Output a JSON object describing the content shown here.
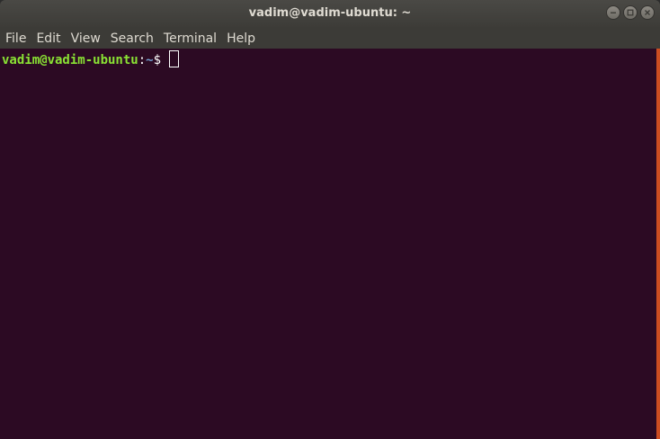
{
  "window": {
    "title": "vadim@vadim-ubuntu: ~",
    "controls": [
      "minimize-icon",
      "maximize-icon",
      "close-icon"
    ]
  },
  "menu": {
    "items": [
      "File",
      "Edit",
      "View",
      "Search",
      "Terminal",
      "Help"
    ]
  },
  "terminal": {
    "prompt_user": "vadim@vadim-ubuntu",
    "prompt_colon": ":",
    "prompt_path": "~",
    "prompt_symbol": "$ ",
    "input": ""
  },
  "colors": {
    "terminal_bg": "#2c0a23",
    "prompt_user": "#8ae234",
    "prompt_path": "#729fcf",
    "accent": "#e95420",
    "titlebar": "#3d3c38"
  }
}
